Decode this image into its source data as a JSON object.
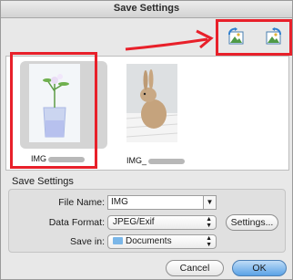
{
  "window": {
    "title": "Save Settings"
  },
  "toolbar": {
    "rotate_left_icon": "rotate-left-icon",
    "rotate_right_icon": "rotate-right-icon"
  },
  "thumbnails": [
    {
      "caption": "IMG",
      "selected": true,
      "icon": "glass-with-flowers"
    },
    {
      "caption": "IMG_",
      "selected": false,
      "icon": "rabbit-photo"
    }
  ],
  "section_title": "Save Settings",
  "form": {
    "file_name_label": "File Name:",
    "file_name_value": "IMG",
    "data_format_label": "Data Format:",
    "data_format_value": "JPEG/Exif",
    "settings_button": "Settings...",
    "save_in_label": "Save in:",
    "save_in_value": "Documents"
  },
  "footer": {
    "cancel_label": "Cancel",
    "ok_label": "OK"
  },
  "colors": {
    "annotation_red": "#e8202a",
    "accent_blue": "#5aa2e6"
  }
}
